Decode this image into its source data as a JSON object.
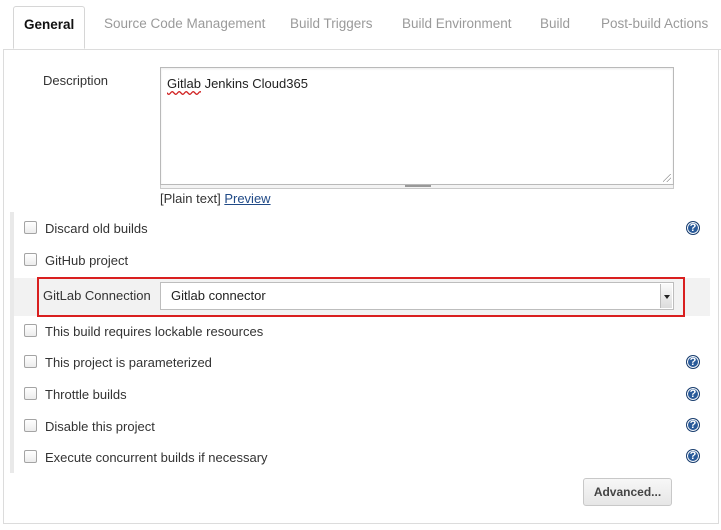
{
  "tabs": [
    {
      "label": "General",
      "active": true
    },
    {
      "label": "Source Code Management",
      "active": false
    },
    {
      "label": "Build Triggers",
      "active": false
    },
    {
      "label": "Build Environment",
      "active": false
    },
    {
      "label": "Build",
      "active": false
    },
    {
      "label": "Post-build Actions",
      "active": false
    }
  ],
  "description": {
    "label": "Description",
    "value_word1": "Gitlab",
    "value_rest": " Jenkins Cloud365",
    "format_text": "[Plain text]",
    "preview_link": "Preview"
  },
  "options": [
    {
      "label": "Discard old builds",
      "checked": false,
      "help": true
    },
    {
      "label": "GitHub project",
      "checked": false,
      "help": false
    },
    {
      "label": "This build requires lockable resources",
      "checked": false,
      "help": false
    },
    {
      "label": "This project is parameterized",
      "checked": false,
      "help": true
    },
    {
      "label": "Throttle builds",
      "checked": false,
      "help": true
    },
    {
      "label": "Disable this project",
      "checked": false,
      "help": true
    },
    {
      "label": "Execute concurrent builds if necessary",
      "checked": false,
      "help": true
    }
  ],
  "gitlab_connection": {
    "label": "GitLab Connection",
    "selected": "Gitlab connector"
  },
  "advanced_button": "Advanced...",
  "help_glyph": "?",
  "colors": {
    "highlight_border": "#d91f1f",
    "help_icon": "#2a5b9a",
    "link": "#204a87"
  }
}
